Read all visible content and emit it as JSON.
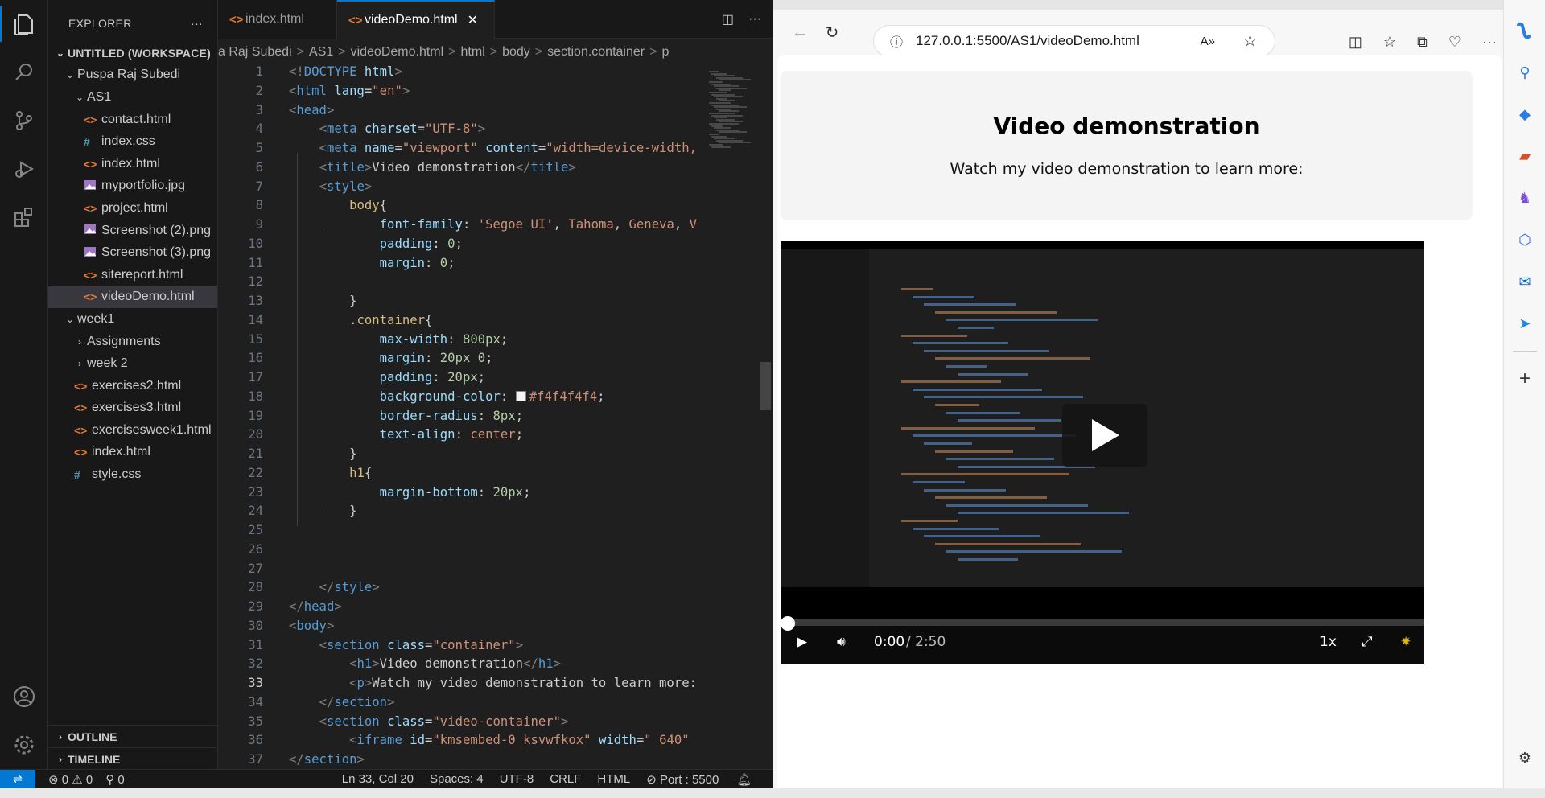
{
  "explorer": {
    "title": "EXPLORER",
    "workspace": "UNTITLED (WORKSPACE)",
    "folder": "Puspa Raj Subedi",
    "subfolder": "AS1",
    "as1_files": [
      {
        "name": "contact.html",
        "type": "html"
      },
      {
        "name": "index.css",
        "type": "css"
      },
      {
        "name": "index.html",
        "type": "html"
      },
      {
        "name": "myportfolio.jpg",
        "type": "img"
      },
      {
        "name": "project.html",
        "type": "html"
      },
      {
        "name": "Screenshot (2).png",
        "type": "img"
      },
      {
        "name": "Screenshot (3).png",
        "type": "img"
      },
      {
        "name": "sitereport.html",
        "type": "html"
      },
      {
        "name": "videoDemo.html",
        "type": "html"
      }
    ],
    "week1": "week1",
    "assignments": "Assignments",
    "week2": "week 2",
    "root_files": [
      {
        "name": "exercises2.html",
        "type": "html"
      },
      {
        "name": "exercises3.html",
        "type": "html"
      },
      {
        "name": "exercisesweek1.html",
        "type": "html"
      },
      {
        "name": "index.html",
        "type": "html"
      },
      {
        "name": "style.css",
        "type": "css"
      }
    ],
    "outline": "OUTLINE",
    "timeline": "TIMELINE"
  },
  "tabs": [
    {
      "label": "index.html"
    },
    {
      "label": "videoDemo.html"
    }
  ],
  "breadcrumb": [
    "a Raj Subedi",
    ">",
    "AS1",
    ">",
    "videoDemo.html",
    ">",
    "html",
    ">",
    "body",
    ">",
    "section.container",
    ">",
    "p"
  ],
  "code_lines": [
    [
      [
        "pu",
        "<!"
      ],
      [
        "tg",
        "DOCTYPE"
      ],
      [
        "pl",
        " "
      ],
      [
        "at",
        "html"
      ],
      [
        "pu",
        ">"
      ]
    ],
    [
      [
        "pu",
        "<"
      ],
      [
        "tg",
        "html"
      ],
      [
        "pl",
        " "
      ],
      [
        "at",
        "lang"
      ],
      [
        "pl",
        "="
      ],
      [
        "st",
        "\"en\""
      ],
      [
        "pu",
        ">"
      ]
    ],
    [
      [
        "pu",
        "<"
      ],
      [
        "tg",
        "head"
      ],
      [
        "pu",
        ">"
      ]
    ],
    [
      [
        "pl",
        "    "
      ],
      [
        "pu",
        "<"
      ],
      [
        "tg",
        "meta"
      ],
      [
        "pl",
        " "
      ],
      [
        "at",
        "charset"
      ],
      [
        "pl",
        "="
      ],
      [
        "st",
        "\"UTF-8\""
      ],
      [
        "pu",
        ">"
      ]
    ],
    [
      [
        "pl",
        "    "
      ],
      [
        "pu",
        "<"
      ],
      [
        "tg",
        "meta"
      ],
      [
        "pl",
        " "
      ],
      [
        "at",
        "name"
      ],
      [
        "pl",
        "="
      ],
      [
        "st",
        "\"viewport\""
      ],
      [
        "pl",
        " "
      ],
      [
        "at",
        "content"
      ],
      [
        "pl",
        "="
      ],
      [
        "st",
        "\"width=device-width,"
      ]
    ],
    [
      [
        "pl",
        "    "
      ],
      [
        "pu",
        "<"
      ],
      [
        "tg",
        "title"
      ],
      [
        "pu",
        ">"
      ],
      [
        "pl",
        "Video demonstration"
      ],
      [
        "pu",
        "</"
      ],
      [
        "tg",
        "title"
      ],
      [
        "pu",
        ">"
      ]
    ],
    [
      [
        "pl",
        "    "
      ],
      [
        "pu",
        "<"
      ],
      [
        "tg",
        "style"
      ],
      [
        "pu",
        ">"
      ]
    ],
    [
      [
        "pl",
        "        "
      ],
      [
        "sel",
        "body"
      ],
      [
        "pl",
        "{"
      ]
    ],
    [
      [
        "pl",
        "            "
      ],
      [
        "at",
        "font-family"
      ],
      [
        "pl",
        ": "
      ],
      [
        "cssv",
        "'Segoe UI'"
      ],
      [
        "pl",
        ", "
      ],
      [
        "cssv",
        "Tahoma"
      ],
      [
        "pl",
        ", "
      ],
      [
        "cssv",
        "Geneva"
      ],
      [
        "pl",
        ", "
      ],
      [
        "cssv",
        "V"
      ]
    ],
    [
      [
        "pl",
        "            "
      ],
      [
        "at",
        "padding"
      ],
      [
        "pl",
        ": "
      ],
      [
        "nu",
        "0"
      ],
      [
        "pl",
        ";"
      ]
    ],
    [
      [
        "pl",
        "            "
      ],
      [
        "at",
        "margin"
      ],
      [
        "pl",
        ": "
      ],
      [
        "nu",
        "0"
      ],
      [
        "pl",
        ";"
      ]
    ],
    [
      [
        "pl",
        ""
      ]
    ],
    [
      [
        "pl",
        "        }"
      ]
    ],
    [
      [
        "pl",
        "        "
      ],
      [
        "sel",
        ".container"
      ],
      [
        "pl",
        "{"
      ]
    ],
    [
      [
        "pl",
        "            "
      ],
      [
        "at",
        "max-width"
      ],
      [
        "pl",
        ": "
      ],
      [
        "nu",
        "800px"
      ],
      [
        "pl",
        ";"
      ]
    ],
    [
      [
        "pl",
        "            "
      ],
      [
        "at",
        "margin"
      ],
      [
        "pl",
        ": "
      ],
      [
        "nu",
        "20px"
      ],
      [
        "pl",
        " "
      ],
      [
        "nu",
        "0"
      ],
      [
        "pl",
        ";"
      ]
    ],
    [
      [
        "pl",
        "            "
      ],
      [
        "at",
        "padding"
      ],
      [
        "pl",
        ": "
      ],
      [
        "nu",
        "20px"
      ],
      [
        "pl",
        ";"
      ]
    ],
    [
      [
        "pl",
        "            "
      ],
      [
        "at",
        "background-color"
      ],
      [
        "pl",
        ": "
      ],
      [
        "sw",
        ""
      ],
      [
        "cssv",
        "#f4f4f4f4"
      ],
      [
        "pl",
        ";"
      ]
    ],
    [
      [
        "pl",
        "            "
      ],
      [
        "at",
        "border-radius"
      ],
      [
        "pl",
        ": "
      ],
      [
        "nu",
        "8px"
      ],
      [
        "pl",
        ";"
      ]
    ],
    [
      [
        "pl",
        "            "
      ],
      [
        "at",
        "text-align"
      ],
      [
        "pl",
        ": "
      ],
      [
        "cssv",
        "center"
      ],
      [
        "pl",
        ";"
      ]
    ],
    [
      [
        "pl",
        "        }"
      ]
    ],
    [
      [
        "pl",
        "        "
      ],
      [
        "sel",
        "h1"
      ],
      [
        "pl",
        "{"
      ]
    ],
    [
      [
        "pl",
        "            "
      ],
      [
        "at",
        "margin-bottom"
      ],
      [
        "pl",
        ": "
      ],
      [
        "nu",
        "20px"
      ],
      [
        "pl",
        ";"
      ]
    ],
    [
      [
        "pl",
        "        }"
      ]
    ],
    [
      [
        "pl",
        ""
      ]
    ],
    [
      [
        "pl",
        ""
      ]
    ],
    [
      [
        "pl",
        ""
      ]
    ],
    [
      [
        "pl",
        "    "
      ],
      [
        "pu",
        "</"
      ],
      [
        "tg",
        "style"
      ],
      [
        "pu",
        ">"
      ]
    ],
    [
      [
        "pu",
        "</"
      ],
      [
        "tg",
        "head"
      ],
      [
        "pu",
        ">"
      ]
    ],
    [
      [
        "pu",
        "<"
      ],
      [
        "tg",
        "body"
      ],
      [
        "pu",
        ">"
      ]
    ],
    [
      [
        "pl",
        "    "
      ],
      [
        "pu",
        "<"
      ],
      [
        "tg",
        "section"
      ],
      [
        "pl",
        " "
      ],
      [
        "at",
        "class"
      ],
      [
        "pl",
        "="
      ],
      [
        "st",
        "\"container\""
      ],
      [
        "pu",
        ">"
      ]
    ],
    [
      [
        "pl",
        "        "
      ],
      [
        "pu",
        "<"
      ],
      [
        "tg",
        "h1"
      ],
      [
        "pu",
        ">"
      ],
      [
        "pl",
        "Video demonstration"
      ],
      [
        "pu",
        "</"
      ],
      [
        "tg",
        "h1"
      ],
      [
        "pu",
        ">"
      ]
    ],
    [
      [
        "pl",
        "        "
      ],
      [
        "pu",
        "<"
      ],
      [
        "tg",
        "p"
      ],
      [
        "pu",
        ">"
      ],
      [
        "pl",
        "Watch my video demonstration to learn more:"
      ]
    ],
    [
      [
        "pl",
        "    "
      ],
      [
        "pu",
        "</"
      ],
      [
        "tg",
        "section"
      ],
      [
        "pu",
        ">"
      ]
    ],
    [
      [
        "pl",
        "    "
      ],
      [
        "pu",
        "<"
      ],
      [
        "tg",
        "section"
      ],
      [
        "pl",
        " "
      ],
      [
        "at",
        "class"
      ],
      [
        "pl",
        "="
      ],
      [
        "st",
        "\"video-container\""
      ],
      [
        "pu",
        ">"
      ]
    ],
    [
      [
        "pl",
        "        "
      ],
      [
        "pu",
        "<"
      ],
      [
        "tg",
        "iframe"
      ],
      [
        "pl",
        " "
      ],
      [
        "at",
        "id"
      ],
      [
        "pl",
        "="
      ],
      [
        "st",
        "\"kmsembed-0_ksvwfkox\""
      ],
      [
        "pl",
        " "
      ],
      [
        "at",
        "width"
      ],
      [
        "pl",
        "="
      ],
      [
        "st",
        "\" 640\""
      ]
    ],
    [
      [
        "pu",
        "</"
      ],
      [
        "tg",
        "section"
      ],
      [
        "pu",
        ">"
      ]
    ]
  ],
  "current_line": 33,
  "status": {
    "errors": "0",
    "warnings": "0",
    "ports": "0",
    "position": "Ln 33, Col 20",
    "spaces": "Spaces: 4",
    "encoding": "UTF-8",
    "eol": "CRLF",
    "language": "HTML",
    "port": "Port : 5500"
  },
  "browser": {
    "url": "127.0.0.1:5500/AS1/videoDemo.html"
  },
  "page": {
    "heading": "Video demonstration",
    "text": "Watch my video demonstration to learn more:"
  },
  "video": {
    "current_time": "0:00",
    "duration": "/ 2:50",
    "speed": "1x",
    "progress": 0
  },
  "colors": {
    "accent": "#0078d4",
    "swatch": "#f4f4f4"
  }
}
